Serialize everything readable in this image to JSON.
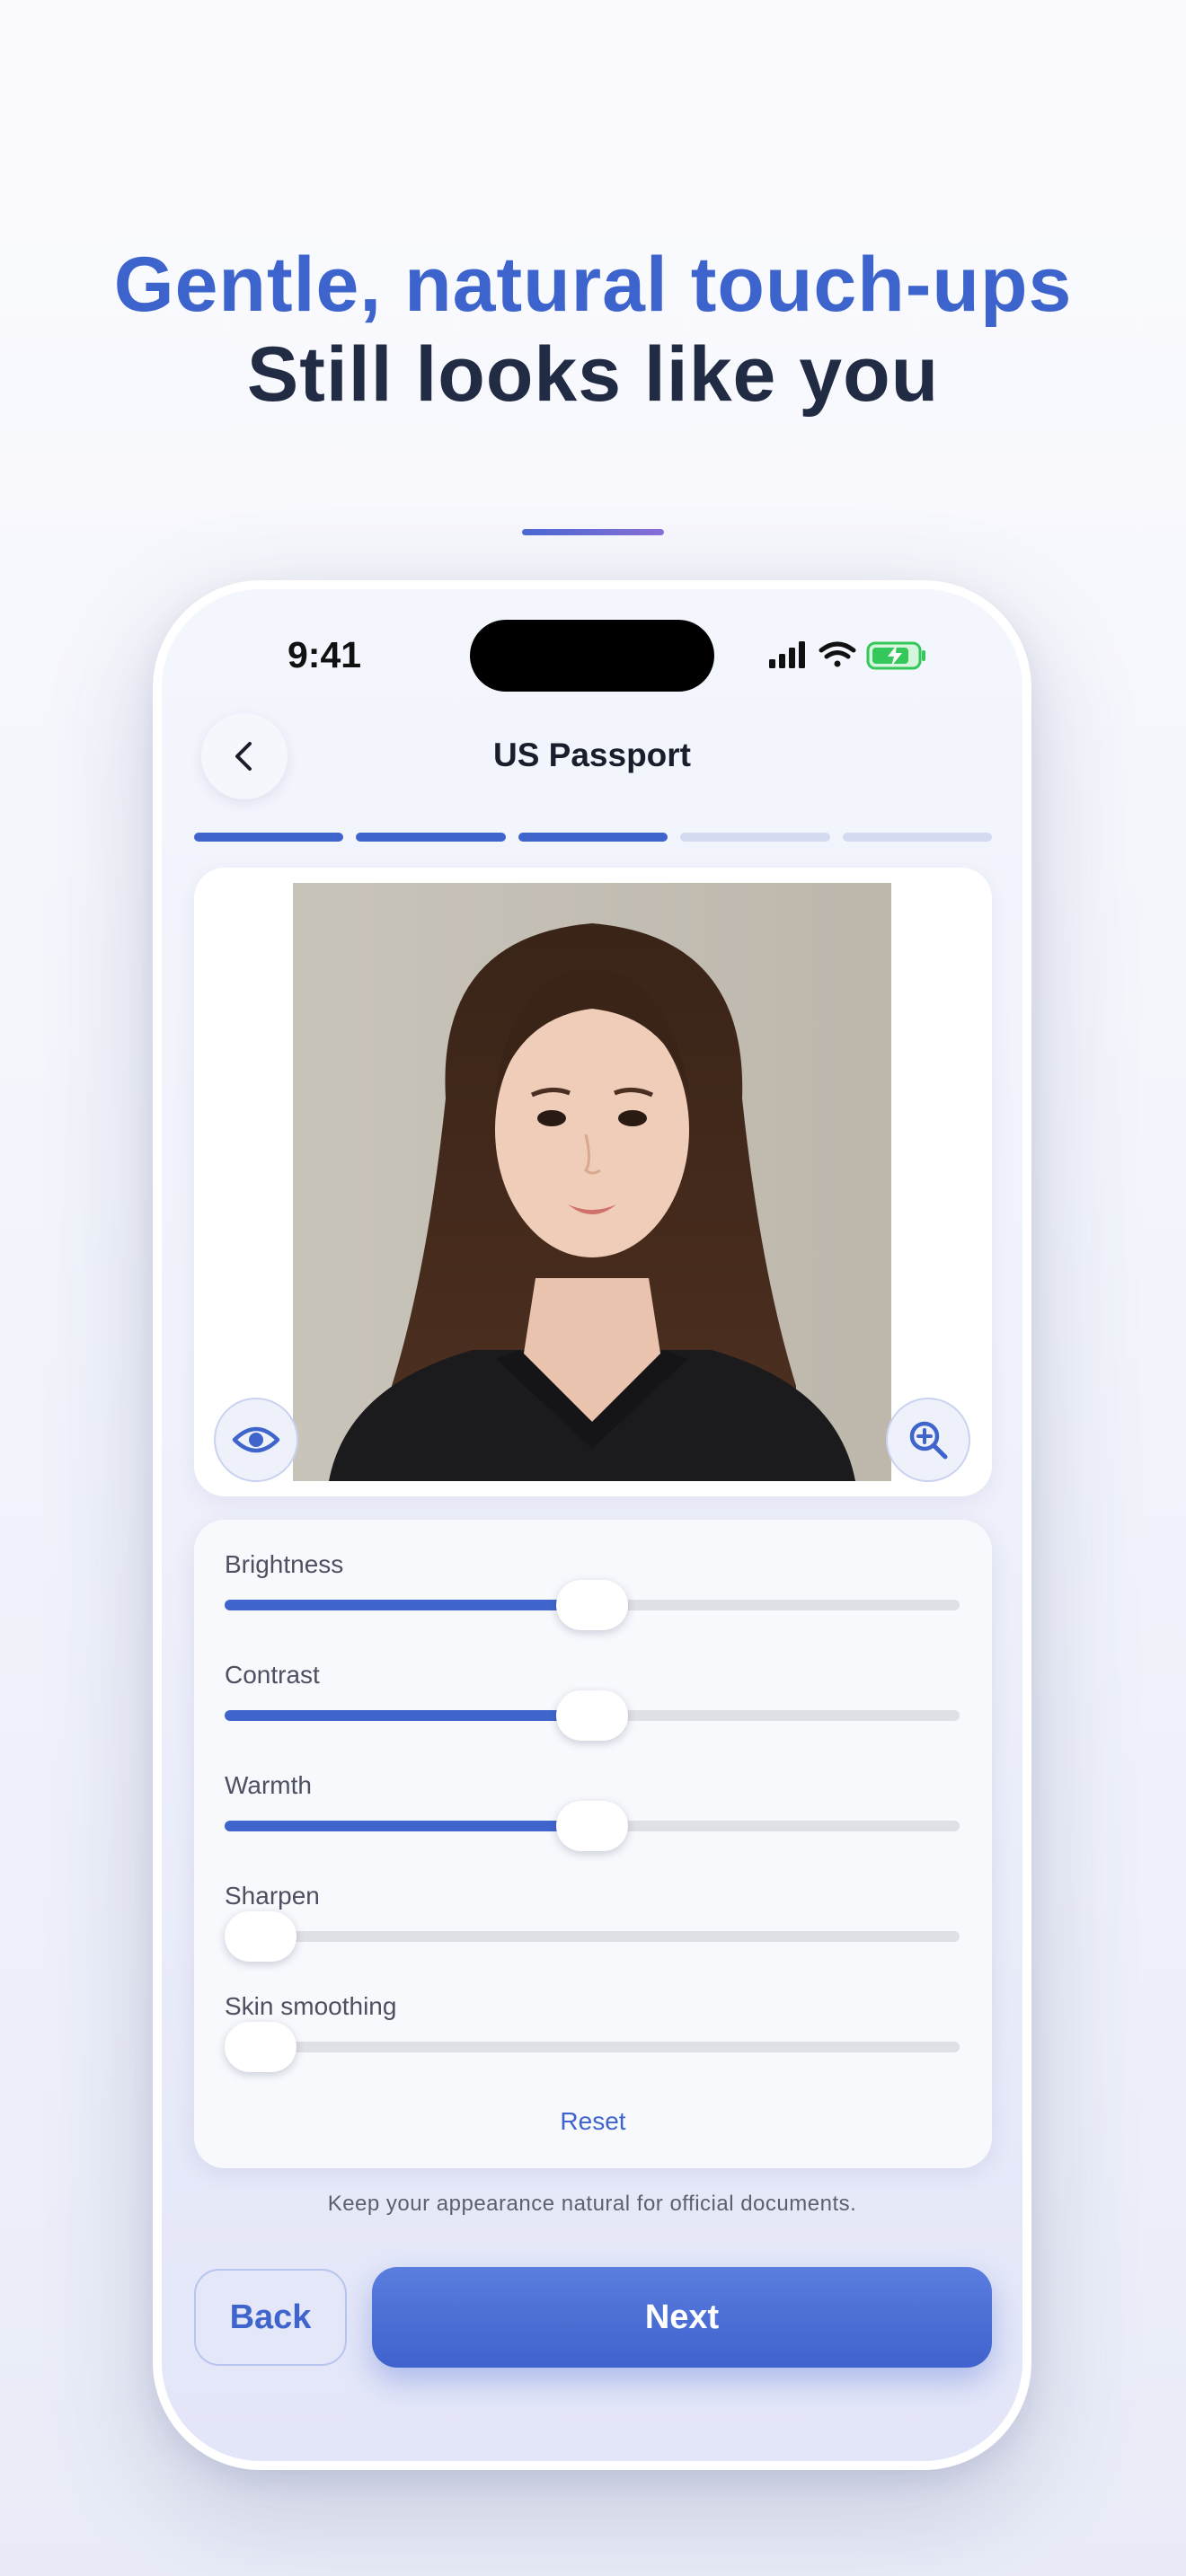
{
  "headline": {
    "line1": "Gentle, natural touch-ups",
    "line2": "Still looks like you"
  },
  "status_bar": {
    "time": "9:41",
    "icons": [
      "cellular-signal-icon",
      "wifi-icon",
      "battery-charging-icon"
    ]
  },
  "nav": {
    "title": "US Passport",
    "back_icon": "chevron-left-icon"
  },
  "progress": {
    "total_steps": 5,
    "completed_steps": 3
  },
  "photo_card": {
    "preview_icon": "eye-icon",
    "zoom_icon": "zoom-in-icon"
  },
  "adjustments": {
    "sliders": [
      {
        "label": "Brightness",
        "value": 0.5
      },
      {
        "label": "Contrast",
        "value": 0.5
      },
      {
        "label": "Warmth",
        "value": 0.5
      },
      {
        "label": "Sharpen",
        "value": 0.0
      },
      {
        "label": "Skin smoothing",
        "value": 0.0
      }
    ],
    "reset_label": "Reset"
  },
  "hint": "Keep your appearance natural for official documents.",
  "buttons": {
    "back_label": "Back",
    "next_label": "Next"
  },
  "colors": {
    "accent": "#3f65cd",
    "headline_dark": "#222b44",
    "battery_green": "#34c759"
  }
}
